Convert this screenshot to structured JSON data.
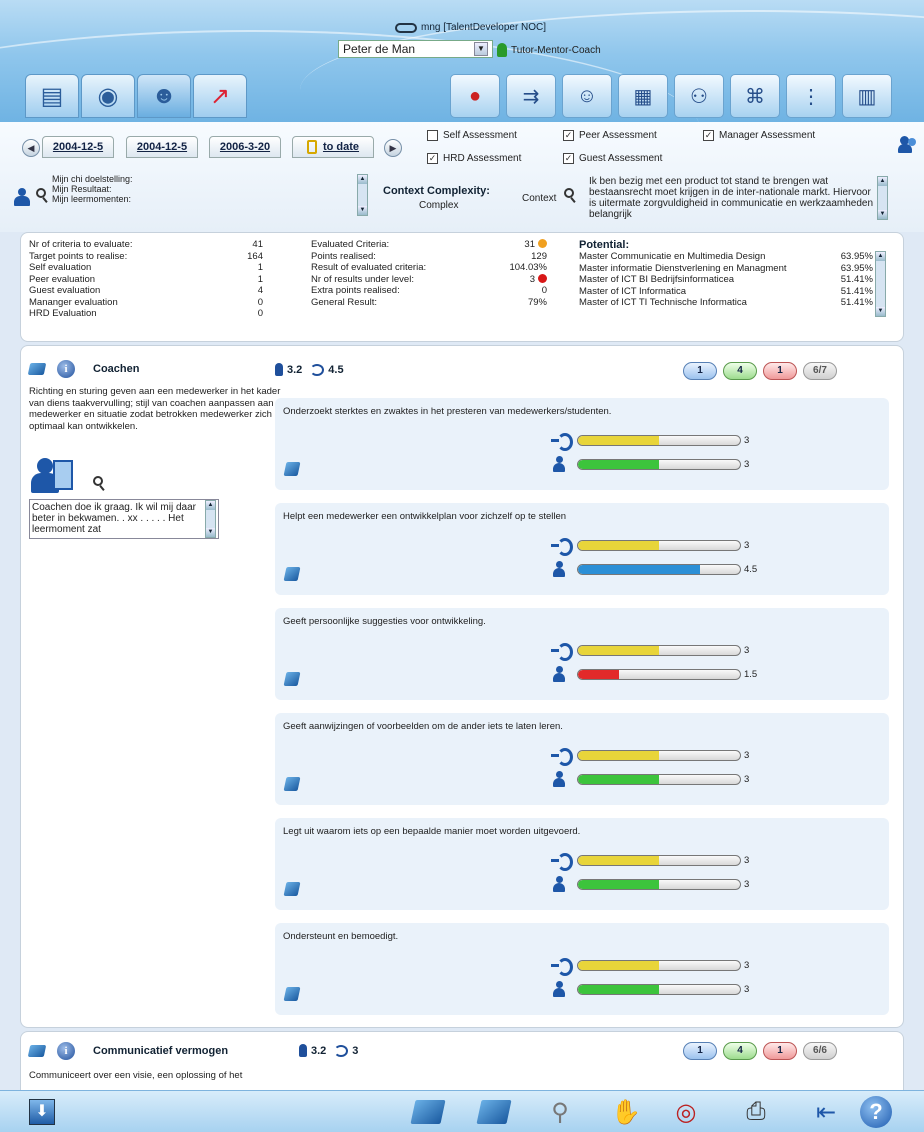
{
  "header": {
    "login": "mng [TalentDeveloper NOC]",
    "person": "Peter de Man",
    "role": "Tutor-Mentor-Coach",
    "tabs": [
      "report-icon",
      "radar-icon",
      "people-icon",
      "chart-icon"
    ],
    "tools": [
      "traffic-light-icon",
      "flow-icon",
      "assess-icon",
      "calendar-icon",
      "group-icon",
      "network-icon",
      "hierarchy-icon",
      "ranking-icon"
    ]
  },
  "dates": {
    "d1": "2004-12-5",
    "d2": "2004-12-5",
    "d3": "2006-3-20",
    "todate": "to date"
  },
  "checks": {
    "self": {
      "label": "Self Assessment",
      "checked": false
    },
    "peer": {
      "label": "Peer Assessment",
      "checked": true
    },
    "manager": {
      "label": "Manager Assessment",
      "checked": true
    },
    "hrd": {
      "label": "HRD Assessment",
      "checked": true
    },
    "guest": {
      "label": "Guest Assessment",
      "checked": true
    }
  },
  "goals": [
    "Mijn chi doelstelling:",
    "Mijn Resultaat:",
    "Mijn leermomenten:"
  ],
  "context": {
    "title": "Context Complexity:",
    "value": "Complex",
    "label": "Context",
    "text": "Ik ben bezig met een product tot stand te brengen wat bestaansrecht moet krijgen in de inter-nationale markt. Hiervoor is uitermate zorgvuldigheid in communicatie en werkzaamheden belangrijk"
  },
  "stats": {
    "left": [
      {
        "label": "Nr of criteria to evaluate:",
        "value": "41"
      },
      {
        "label": "Target points to realise:",
        "value": "164"
      },
      {
        "label": "Self evaluation",
        "value": "1"
      },
      {
        "label": "Peer evaluation",
        "value": "1"
      },
      {
        "label": "Guest evaluation",
        "value": "4"
      },
      {
        "label": "Mananger evaluation",
        "value": "0"
      },
      {
        "label": "HRD Evaluation",
        "value": "0"
      }
    ],
    "middle": [
      {
        "label": "Evaluated Criteria:",
        "value": "31"
      },
      {
        "label": "Points realised:",
        "value": "129"
      },
      {
        "label": "Result of evaluated criteria:",
        "value": "104.03%"
      },
      {
        "label": "Nr of results under level:",
        "value": "3"
      },
      {
        "label": "Extra points realised:",
        "value": "0"
      },
      {
        "label": "General Result:",
        "value": "79%"
      }
    ],
    "potential_title": "Potential:",
    "potential": [
      {
        "label": "Master Communicatie en Multimedia Design",
        "value": "63.95%"
      },
      {
        "label": "Master informatie Dienstverlening en Managment",
        "value": "63.95%"
      },
      {
        "label": "Master of ICT BI Bedrijfsinformaticea",
        "value": "51.41%"
      },
      {
        "label": "Master of ICT Informatica",
        "value": "51.41%"
      },
      {
        "label": "Master of ICT TI Technische Informatica",
        "value": "51.41%"
      }
    ]
  },
  "competency": {
    "title": "Coachen",
    "score_person": "3.2",
    "score_ear": "4.5",
    "pills": [
      "1",
      "4",
      "1",
      "6/7"
    ],
    "description": "Richting en sturing geven aan een medewerker in het kader van diens taakvervulling; stijl van coachen aanpassen aan medewerker en situatie zodat betrokken medewerker zich optimaal kan ontwikkelen.",
    "note": "Coachen doe ik graag. Ik wil mij daar beter in bekwamen. . xx . . . . . Het leermoment zat",
    "criteria": [
      {
        "title": "Onderzoekt sterktes en zwaktes in het presteren van medewerkers/studenten.",
        "ear": 3,
        "ear_label": "3",
        "person": 3,
        "person_label": "3",
        "person_color": "#3cc43c"
      },
      {
        "title": "Helpt een medewerker een ontwikkelplan voor zichzelf op te stellen",
        "ear": 3,
        "ear_label": "3",
        "person": 4.5,
        "person_label": "4.5",
        "person_color": "#2b8fd6"
      },
      {
        "title": "Geeft persoonlijke suggesties voor ontwikkeling.",
        "ear": 3,
        "ear_label": "3",
        "person": 1.5,
        "person_label": "1.5",
        "person_color": "#e22a2a"
      },
      {
        "title": "Geeft aanwijzingen of voorbeelden om de ander iets te laten leren.",
        "ear": 3,
        "ear_label": "3",
        "person": 3,
        "person_label": "3",
        "person_color": "#3cc43c"
      },
      {
        "title": "Legt uit waarom iets op een bepaalde manier moet worden uitgevoerd.",
        "ear": 3,
        "ear_label": "3",
        "person": 3,
        "person_label": "3",
        "person_color": "#3cc43c"
      },
      {
        "title": "Ondersteunt en bemoedigt.",
        "ear": 3,
        "ear_label": "3",
        "person": 3,
        "person_label": "3",
        "person_color": "#3cc43c"
      }
    ]
  },
  "competency2": {
    "title": "Communicatief vermogen",
    "score_person": "3.2",
    "score_ear": "3",
    "pills": [
      "1",
      "4",
      "1",
      "6/6"
    ],
    "description": "Communiceert over een visie, een oplossing of het"
  },
  "bottom": [
    "download-icon",
    "folder-open-icon",
    "folder-icon",
    "lightbulb-icon",
    "thumbs-up-icon",
    "compass-icon",
    "printer-icon",
    "exit-icon",
    "help-icon"
  ],
  "colors": {
    "ear_fill": "#e8d53a",
    "scale_max": 6
  }
}
